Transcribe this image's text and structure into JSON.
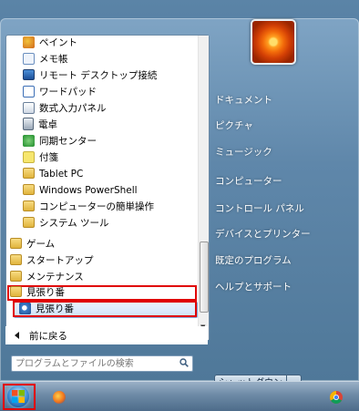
{
  "programs": [
    {
      "label": "ペイント",
      "icon": "paint-icon"
    },
    {
      "label": "メモ帳",
      "icon": "notepad-icon"
    },
    {
      "label": "リモート デスクトップ接続",
      "icon": "remote-desktop-icon"
    },
    {
      "label": "ワードパッド",
      "icon": "wordpad-icon"
    },
    {
      "label": "数式入力パネル",
      "icon": "math-input-icon"
    },
    {
      "label": "電卓",
      "icon": "calculator-icon"
    },
    {
      "label": "同期センター",
      "icon": "sync-center-icon"
    },
    {
      "label": "付箋",
      "icon": "sticky-notes-icon"
    },
    {
      "label": "Tablet PC",
      "icon": "folder-icon"
    },
    {
      "label": "Windows PowerShell",
      "icon": "folder-icon"
    },
    {
      "label": "コンピューターの簡単操作",
      "icon": "folder-icon"
    },
    {
      "label": "システム ツール",
      "icon": "folder-icon"
    },
    {
      "label": "ゲーム",
      "icon": "folder-icon"
    },
    {
      "label": "スタートアップ",
      "icon": "folder-icon"
    },
    {
      "label": "メンテナンス",
      "icon": "folder-icon"
    },
    {
      "label": "見張り番",
      "icon": "folder-icon"
    },
    {
      "label": "見張り番",
      "icon": "app-icon"
    }
  ],
  "back": {
    "label": "前に戻る"
  },
  "search": {
    "placeholder": "プログラムとファイルの検索"
  },
  "right_items": [
    {
      "label": "ドキュメント"
    },
    {
      "label": "ピクチャ"
    },
    {
      "label": "ミュージック"
    },
    {
      "label": "コンピューター"
    },
    {
      "label": "コントロール パネル"
    },
    {
      "label": "デバイスとプリンター"
    },
    {
      "label": "既定のプログラム"
    },
    {
      "label": "ヘルプとサポート"
    }
  ],
  "shutdown": {
    "label": "シャットダウン"
  },
  "colors": {
    "highlight": "#e00000",
    "selection": "#cfe3fa"
  }
}
